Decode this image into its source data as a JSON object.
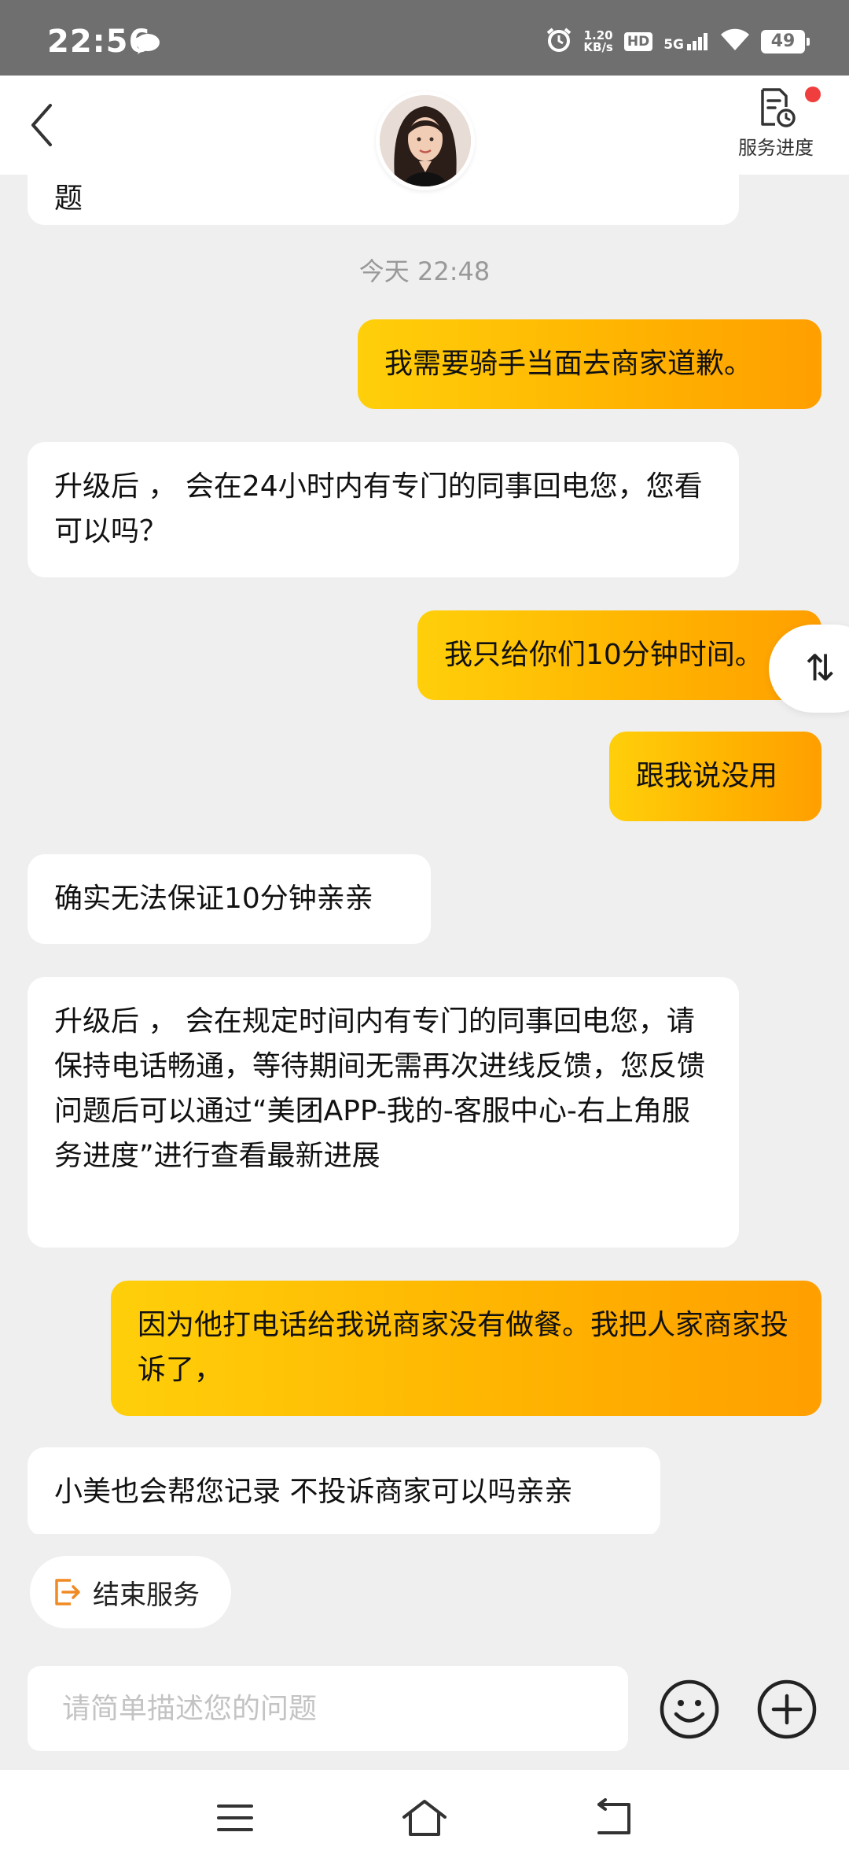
{
  "status_bar": {
    "time": "22:56",
    "speed_value": "1.20",
    "speed_unit": "KB/s",
    "hd": "HD",
    "network": "5G",
    "battery": "49"
  },
  "header": {
    "service_progress_label": "服务进度"
  },
  "chat": {
    "prev_fragment": "题",
    "timestamp": "今天 22:48",
    "messages": [
      {
        "side": "right",
        "text": "我需要骑手当面去商家道歉。"
      },
      {
        "side": "left",
        "text": "升级后 ， 会在24小时内有专门的同事回电您，您看可以吗？"
      },
      {
        "side": "right",
        "text": "我只给你们10分钟时间。"
      },
      {
        "side": "right",
        "text": "跟我说没用"
      },
      {
        "side": "left",
        "text": "确实无法保证10分钟亲亲"
      },
      {
        "side": "left",
        "text": "升级后 ， 会在规定时间内有专门的同事回电您，请保持电话畅通，等待期间无需再次进线反馈，您反馈问题后可以通过“美团APP-我的-客服中心-右上角服务进度”进行查看最新进展"
      },
      {
        "side": "right",
        "text": "因为他打电话给我说商家没有做餐。我把人家商家投诉了，"
      },
      {
        "side": "left",
        "text": "小美也会帮您记录 不投诉商家可以吗亲亲"
      }
    ]
  },
  "scroll_toggle_glyph": "⇅",
  "end_service_label": "结束服务",
  "input": {
    "placeholder": "请简单描述您的问题",
    "value": ""
  },
  "colors": {
    "accent_gradient_start": "#ffcf0a",
    "accent_gradient_end": "#ff9f00",
    "end_service_icon": "#f08a24",
    "notification_dot": "#f03d3d"
  },
  "icons": {
    "back": "chevron-left-icon",
    "service_progress": "document-clock-icon",
    "end_service": "exit-icon",
    "emoji": "smiley-icon",
    "plus": "plus-circle-icon",
    "nav_menu": "menu-icon",
    "nav_home": "home-icon",
    "nav_back": "back-arrow-icon"
  }
}
